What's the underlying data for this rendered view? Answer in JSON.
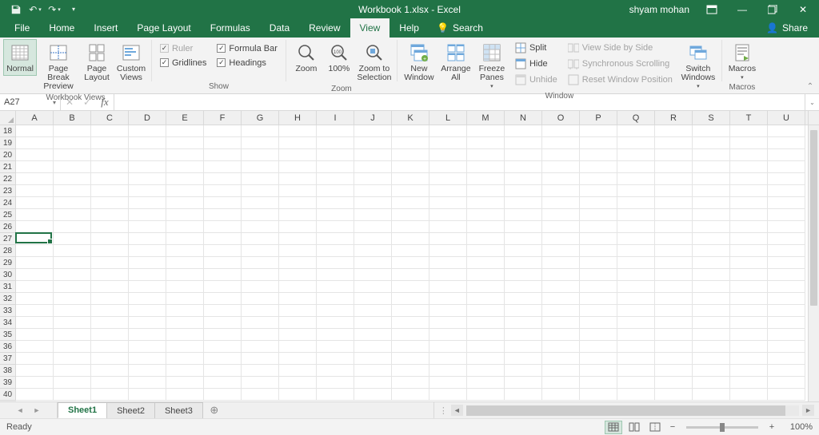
{
  "title": "Workbook 1.xlsx  -  Excel",
  "user": "shyam mohan",
  "qat": {
    "save": "save-icon",
    "undo": "undo-icon",
    "redo": "redo-icon",
    "customize": "customize-qat"
  },
  "window_controls": {
    "ribbon_opts": "ribbon-display-options",
    "minimize": "minimize",
    "maximize": "restore",
    "close": "close"
  },
  "tabs": {
    "file": "File",
    "items": [
      "Home",
      "Insert",
      "Page Layout",
      "Formulas",
      "Data",
      "Review",
      "View",
      "Help"
    ],
    "active": "View",
    "tellme_placeholder": "Search",
    "share": "Share"
  },
  "ribbon": {
    "workbook_views": {
      "label": "Workbook Views",
      "normal": "Normal",
      "page_break": "Page Break\nPreview",
      "page_layout": "Page\nLayout",
      "custom_views": "Custom\nViews"
    },
    "show": {
      "label": "Show",
      "ruler": "Ruler",
      "gridlines": "Gridlines",
      "formula_bar": "Formula Bar",
      "headings": "Headings"
    },
    "zoom": {
      "label": "Zoom",
      "zoom": "Zoom",
      "p100": "100%",
      "to_selection": "Zoom to\nSelection"
    },
    "window": {
      "label": "Window",
      "new_window": "New\nWindow",
      "arrange_all": "Arrange\nAll",
      "freeze_panes": "Freeze\nPanes",
      "split": "Split",
      "hide": "Hide",
      "unhide": "Unhide",
      "view_side": "View Side by Side",
      "sync_scroll": "Synchronous Scrolling",
      "reset_pos": "Reset Window Position",
      "switch": "Switch\nWindows"
    },
    "macros": {
      "label": "Macros",
      "macros": "Macros"
    }
  },
  "namebox": "A27",
  "formula": "",
  "columns": [
    "A",
    "B",
    "C",
    "D",
    "E",
    "F",
    "G",
    "H",
    "I",
    "J",
    "K",
    "L",
    "M",
    "N",
    "O",
    "P",
    "Q",
    "R",
    "S",
    "T",
    "U"
  ],
  "row_start": 18,
  "row_end": 40,
  "active_cell": {
    "col": 0,
    "row_index": 9
  },
  "sheets": {
    "items": [
      "Sheet1",
      "Sheet2",
      "Sheet3"
    ],
    "active": "Sheet1"
  },
  "status": {
    "ready": "Ready",
    "zoom": "100%"
  }
}
